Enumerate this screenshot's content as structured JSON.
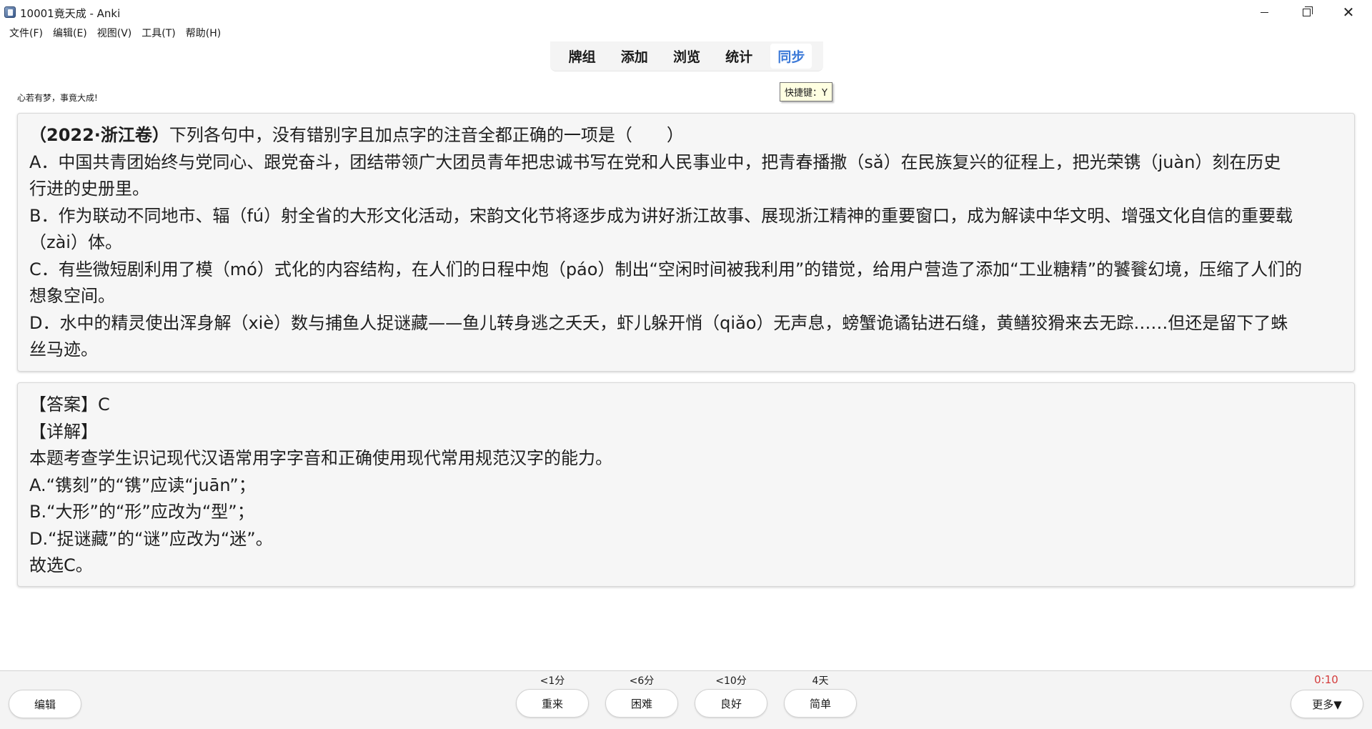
{
  "window": {
    "title": "10001竟天成 - Anki",
    "minimize_symbol": "",
    "close_symbol": "✕"
  },
  "menu": [
    "文件(F)",
    "编辑(E)",
    "视图(V)",
    "工具(T)",
    "帮助(H)"
  ],
  "toolbar": {
    "items": [
      "牌组",
      "添加",
      "浏览",
      "统计",
      "同步"
    ],
    "active": "同步",
    "tooltip": "快捷键：Y"
  },
  "motto": "心若有梦，事竟大成!",
  "question": {
    "source": "（2022·浙江卷）",
    "stem": "下列各句中，没有错别字且加点字的注音全都正确的一项是（　　）",
    "lines": [
      "A．中国共青团始终与党同心、跟党奋斗，团结带领广大团员青年把忠诚书写在党和人民事业中，把青春播撒（sǎ）在民族复兴的征程上，把光荣镌（juàn）刻在历史",
      "行进的史册里。",
      "B．作为联动不同地市、辐（fú）射全省的大形文化活动，宋韵文化节将逐步成为讲好浙江故事、展现浙江精神的重要窗口，成为解读中华文明、增强文化自信的重要载",
      "（zài）体。",
      "C．有些微短剧利用了模（mó）式化的内容结构，在人们的日程中炮（páo）制出“空闲时间被我利用”的错觉，给用户营造了添加“工业糖精”的饕餮幻境，压缩了人们的",
      "想象空间。",
      "D．水中的精灵使出浑身解（xiè）数与捕鱼人捉谜藏——鱼儿转身逃之夭夭，虾儿躲开悄（qiǎo）无声息，螃蟹诡谲钻进石缝，黄鳝狡猾来去无踪……但还是留下了蛛",
      "丝马迹。"
    ]
  },
  "answer": {
    "lines": [
      "【答案】C",
      "【详解】",
      "本题考查学生识记现代汉语常用字字音和正确使用现代常用规范汉字的能力。",
      "A.“镌刻”的“镌”应读“juān”；",
      "B.“大形”的“形”应改为“型”；",
      "D.“捉谜藏”的“谜”应改为“迷”。",
      "故选C。"
    ]
  },
  "bottom": {
    "edit_label": "编辑",
    "more_label": "更多▼",
    "timer": "0:10",
    "ease": [
      {
        "interval": "<1分",
        "label": "重来"
      },
      {
        "interval": "<6分",
        "label": "困难"
      },
      {
        "interval": "<10分",
        "label": "良好"
      },
      {
        "interval": "4天",
        "label": "简单"
      }
    ]
  },
  "colors": {
    "active_tab": "#3d7ad8",
    "timer": "#d43b3b",
    "card_bg": "#f6f6f6"
  }
}
